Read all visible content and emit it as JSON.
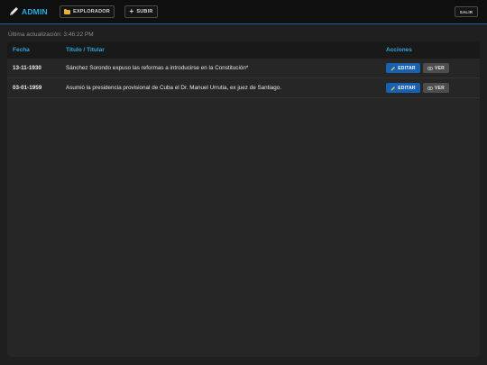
{
  "header": {
    "brand": "ADMIN",
    "explorer_label": "EXPLORADOR",
    "upload_label": "SUBIR",
    "logout_label": "SALIR"
  },
  "status": {
    "updated_label": "Última actualización:",
    "updated_time": "3:46:22 PM"
  },
  "table": {
    "columns": {
      "date": "Fecha",
      "title": "Título / Titular",
      "actions": "Acciones"
    },
    "rows": [
      {
        "date": "13-11-1930",
        "title": "Sánchez Sorondo expuso las reformas a introducirse en la Constitución*",
        "edit_label": "EDITAR",
        "view_label": "VER"
      },
      {
        "date": "03-01-1959",
        "title": "Asumió la presidencia provisional de Cuba el Dr. Manuel Urrutia, ex juez de Santiago.",
        "edit_label": "EDITAR",
        "view_label": "VER"
      }
    ]
  },
  "colors": {
    "accent": "#28aee4",
    "edit_button": "#1761b0",
    "view_button": "#4d4d4d",
    "topbar_border": "#1e5aa8"
  },
  "icons": {
    "brand": "pencil-icon",
    "explorer": "folder-icon",
    "upload": "plus-icon",
    "edit": "pencil-icon",
    "view": "eye-icon"
  }
}
